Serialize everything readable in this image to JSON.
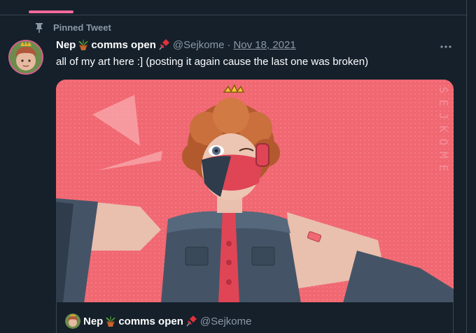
{
  "pinned": {
    "label": "Pinned Tweet"
  },
  "tweet": {
    "name_part1": "Nep",
    "name_part2": "comms open",
    "handle": "@Sejkome",
    "separator": "·",
    "date": "Nov 18, 2021",
    "text": "all of my art here :] (posting it again cause the last one was broken)",
    "media_watermark": "SEJKOME"
  },
  "quote": {
    "name_part1": "Nep",
    "name_part2": "comms open",
    "handle": "@Sejkome"
  },
  "icons": {
    "pin": "pin-icon",
    "plant_emoji": "potted-plant-icon",
    "pushpin_emoji": "pushpin-icon",
    "more": "more-icon"
  },
  "colors": {
    "background": "#15202b",
    "divider": "#38444d",
    "secondary_text": "#8b98a5",
    "accent_pink": "#f4699a",
    "art_background": "#f06872"
  }
}
